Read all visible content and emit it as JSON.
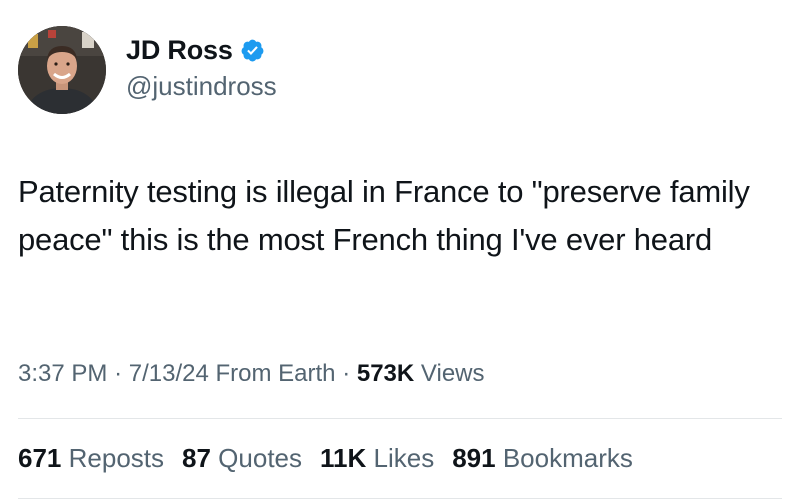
{
  "author": {
    "display_name": "JD Ross",
    "handle": "@justindross",
    "verified_icon": "verified-badge-icon",
    "verified_color": "#1d9bf0"
  },
  "tweet": {
    "text": "Paternity testing is illegal in France to \"preserve family peace\" this is the most French thing I've ever heard"
  },
  "meta": {
    "time": "3:37 PM",
    "separator": "·",
    "date": "7/13/24",
    "source": "From Earth",
    "views_count": "573K",
    "views_label": "Views"
  },
  "stats": {
    "reposts_count": "671",
    "reposts_label": "Reposts",
    "quotes_count": "87",
    "quotes_label": "Quotes",
    "likes_count": "11K",
    "likes_label": "Likes",
    "bookmarks_count": "891",
    "bookmarks_label": "Bookmarks"
  },
  "colors": {
    "text_primary": "#0f1419",
    "text_secondary": "#536471",
    "divider": "#e3e6e8"
  }
}
